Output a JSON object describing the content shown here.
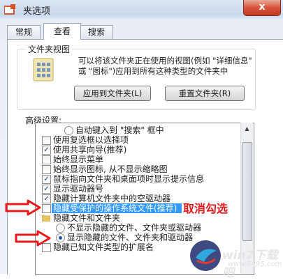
{
  "window": {
    "title": "夹选项",
    "close_label": "x"
  },
  "tabs": [
    {
      "label": "常规",
      "active": false
    },
    {
      "label": "查看",
      "active": true
    },
    {
      "label": "搜索",
      "active": false
    }
  ],
  "folder_views": {
    "group_title": "文件夹视图",
    "description": "可以将该文件夹正在使用的视图(例如 \"详细信息\" 或 \"图标\")应用到所有这种类型的文件夹中",
    "apply_button": "应用到文件夹(L)",
    "reset_button": "重置文件夹(R)"
  },
  "advanced": {
    "label": "高级设置:",
    "items": [
      {
        "type": "radio",
        "label": "自动键入到 \"搜索\" 框中",
        "checked": false
      },
      {
        "type": "checkbox",
        "label": "使用复选框以选择项",
        "checked": false
      },
      {
        "type": "checkbox",
        "label": "使用共享向导(推荐)",
        "checked": true
      },
      {
        "type": "checkbox",
        "label": "始终显示菜单",
        "checked": false
      },
      {
        "type": "checkbox",
        "label": "始终显示图标, 从不显示缩略图",
        "checked": false
      },
      {
        "type": "checkbox",
        "label": "鼠标指向文件夹和桌面项时显示提示信息",
        "checked": true
      },
      {
        "type": "checkbox",
        "label": "显示驱动器号",
        "checked": true
      },
      {
        "type": "checkbox",
        "label": "隐藏计算机文件夹中的空驱动器",
        "checked": true
      },
      {
        "type": "checkbox",
        "label": "隐藏受保护的操作系统文件(推荐)",
        "checked": false
      },
      {
        "type": "folder",
        "label": "隐藏文件和文件夹"
      },
      {
        "type": "radio",
        "label": "不显示隐藏的文件、文件夹或驱动器",
        "checked": false
      },
      {
        "type": "radio",
        "label": "显示隐藏的文件、文件夹和驱动器",
        "checked": true
      },
      {
        "type": "checkbox",
        "label": "隐藏已知文件类型的扩展名",
        "checked": false
      }
    ]
  },
  "annotation": {
    "text": "取消勾选",
    "color": "#e8171a"
  },
  "watermark": {
    "brand": "win7下载吧",
    "url": "www.8495.com"
  },
  "colors": {
    "accent": "#3399ff",
    "annotation_red": "#e8171a"
  }
}
